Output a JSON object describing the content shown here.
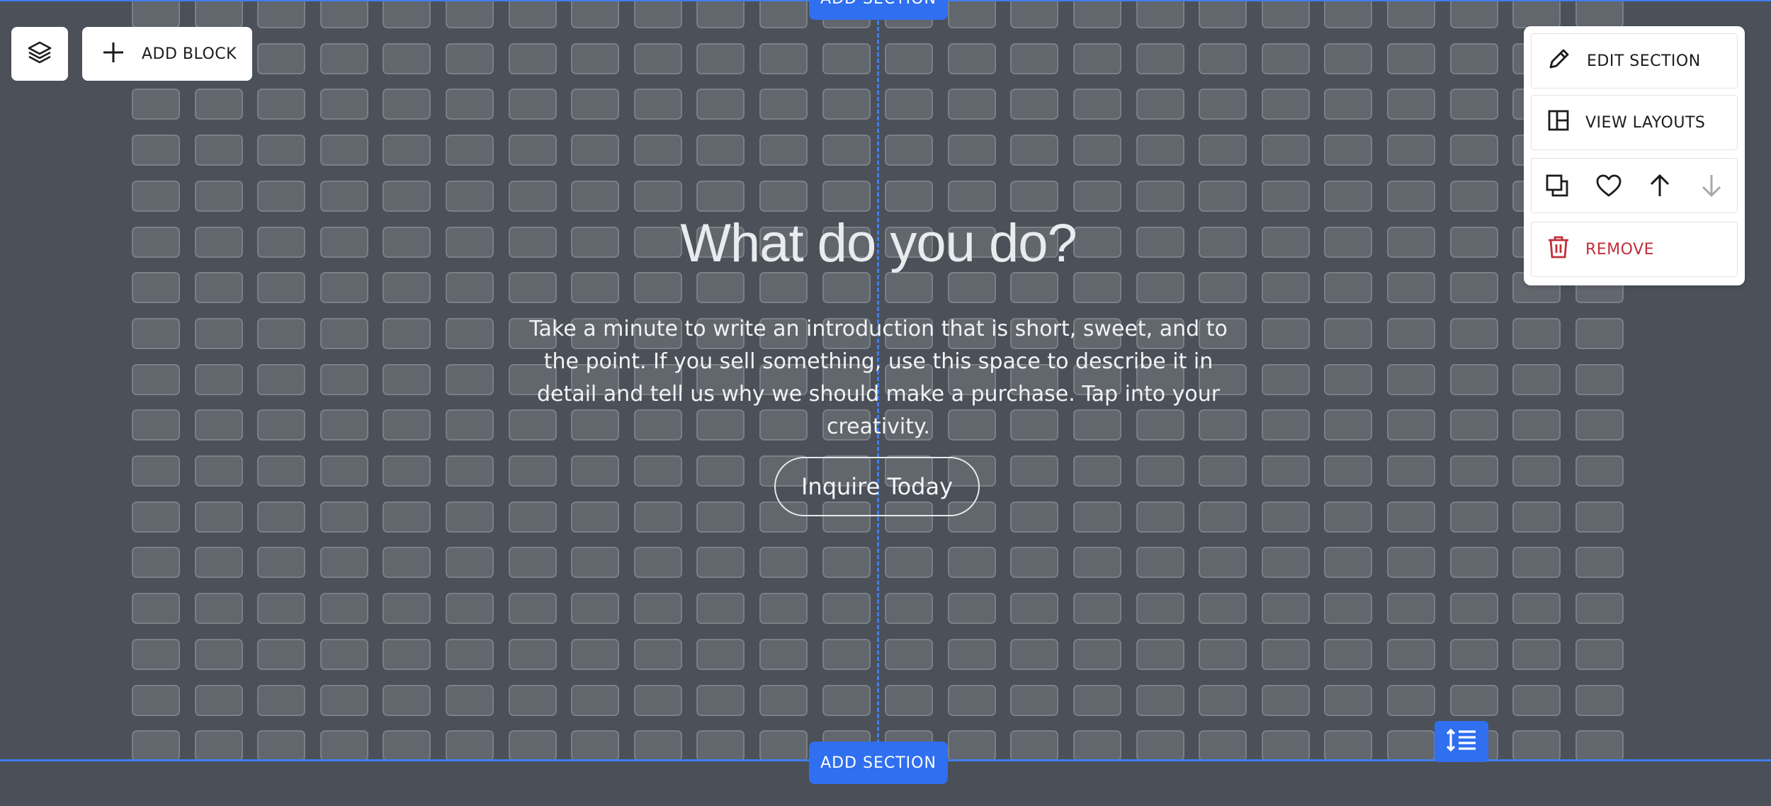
{
  "page": {
    "heading": "What do you do?",
    "intro": "Take a minute to write an introduction that is short, sweet, and to the point. If you sell something, use this space to describe it in detail and tell us why we should make a purchase. Tap into your creativity.",
    "cta_label": "Inquire Today"
  },
  "toolbar": {
    "layers_icon": "layers-icon",
    "add_block_label": "ADD BLOCK"
  },
  "section_controls": {
    "add_section_top": "ADD SECTION",
    "add_section_bottom": "ADD SECTION"
  },
  "panel": {
    "edit_section": "EDIT SECTION",
    "view_layouts": "VIEW LAYOUTS",
    "remove": "REMOVE",
    "icons": [
      "duplicate-icon",
      "heart-icon",
      "arrow-up-icon",
      "arrow-down-icon"
    ]
  },
  "colors": {
    "accent": "#2f6ff0",
    "section_bg": "#4b5059",
    "remove": "#c0303a"
  }
}
